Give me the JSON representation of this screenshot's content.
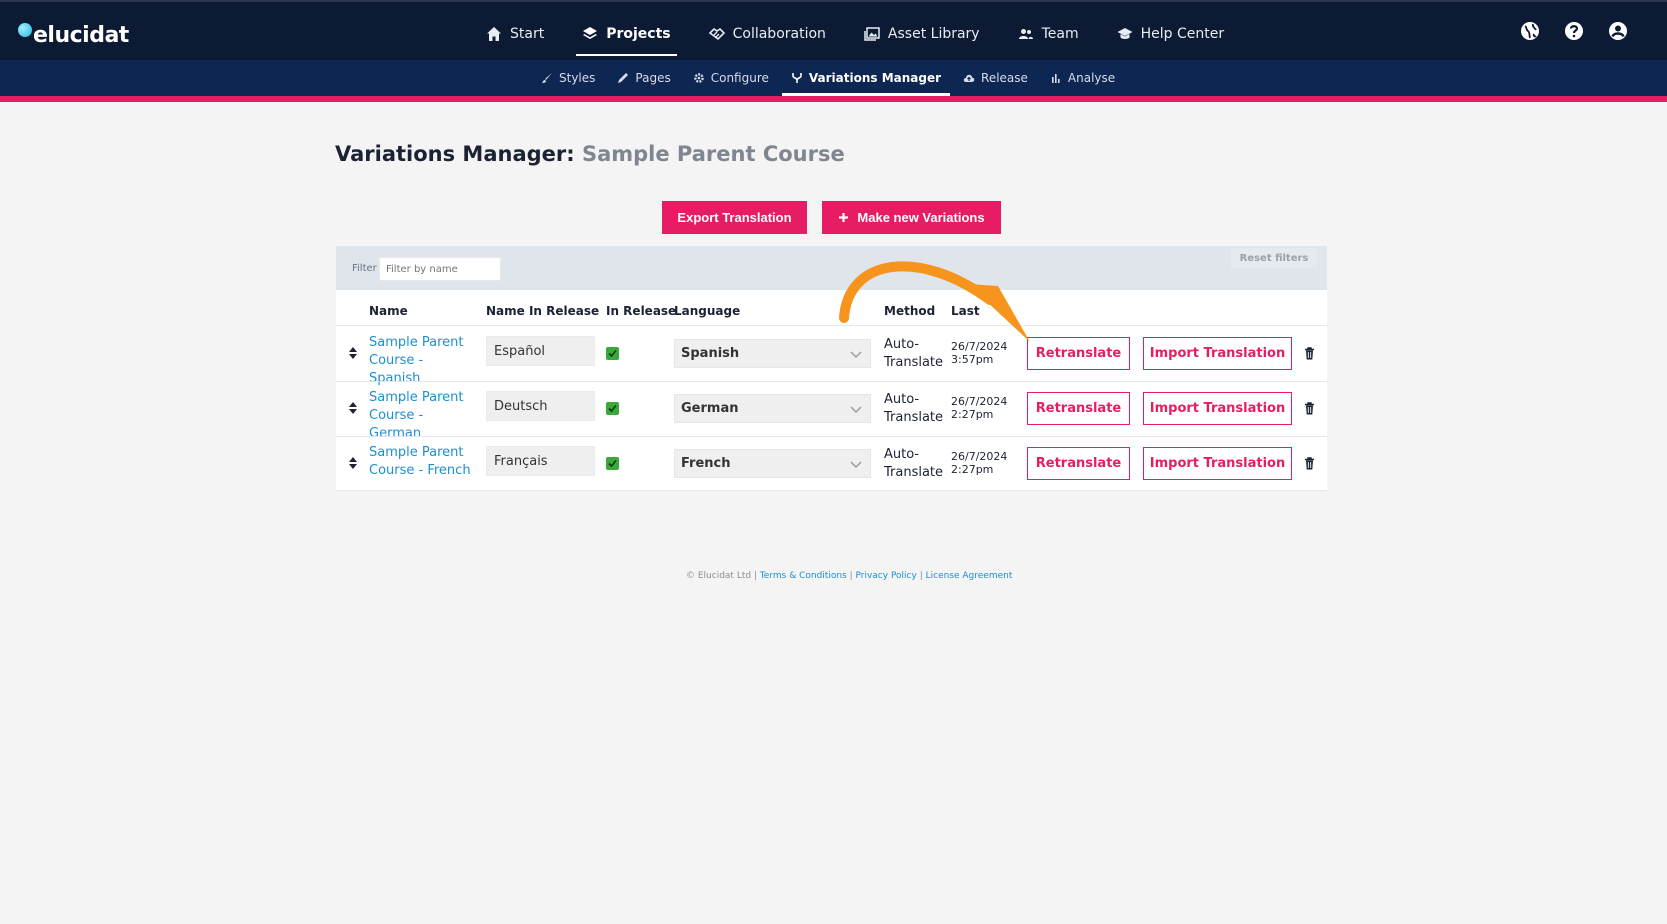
{
  "brand": {
    "name": "elucidat"
  },
  "main_nav": [
    {
      "label": "Start",
      "icon": "home-icon"
    },
    {
      "label": "Projects",
      "icon": "layers-icon",
      "active": true
    },
    {
      "label": "Collaboration",
      "icon": "handshake-icon"
    },
    {
      "label": "Asset Library",
      "icon": "images-icon"
    },
    {
      "label": "Team",
      "icon": "users-icon"
    },
    {
      "label": "Help Center",
      "icon": "graduation-cap-icon"
    }
  ],
  "header_icons": [
    "globe-icon",
    "help-icon",
    "user-icon"
  ],
  "sub_nav": [
    {
      "label": "Styles",
      "icon": "brush-icon"
    },
    {
      "label": "Pages",
      "icon": "pencil-icon"
    },
    {
      "label": "Configure",
      "icon": "gear-icon"
    },
    {
      "label": "Variations Manager",
      "icon": "fork-icon",
      "active": true
    },
    {
      "label": "Release",
      "icon": "cloud-upload-icon"
    },
    {
      "label": "Analyse",
      "icon": "bar-chart-icon"
    }
  ],
  "page": {
    "title_prefix": "Variations Manager:",
    "title_course": "Sample Parent Course",
    "export_button": "Export Translation",
    "make_button": "Make new Variations"
  },
  "filter": {
    "label": "Filter",
    "placeholder": "Filter by name",
    "reset_label": "Reset filters"
  },
  "table": {
    "headers": {
      "name": "Name",
      "name_in_release": "Name In Release",
      "in_release": "In Release",
      "language": "Language",
      "method": "Method",
      "last": "Last"
    },
    "rows": [
      {
        "name_line1": "Sample Parent",
        "name_line2": "Course - Spanish",
        "name_in_release": "Español",
        "in_release": true,
        "language": "Spanish",
        "method_line1": "Auto-",
        "method_line2": "Translate",
        "date": "26/7/2024",
        "time": "3:57pm",
        "retranslate": "Retranslate",
        "import": "Import Translation"
      },
      {
        "name_line1": "Sample Parent",
        "name_line2": "Course - German",
        "name_in_release": "Deutsch",
        "in_release": true,
        "language": "German",
        "method_line1": "Auto-",
        "method_line2": "Translate",
        "date": "26/7/2024",
        "time": "2:27pm",
        "retranslate": "Retranslate",
        "import": "Import Translation"
      },
      {
        "name_line1": "Sample Parent",
        "name_line2": "Course - French",
        "name_in_release": "Français",
        "in_release": true,
        "language": "French",
        "method_line1": "Auto-",
        "method_line2": "Translate",
        "date": "26/7/2024",
        "time": "2:27pm",
        "retranslate": "Retranslate",
        "import": "Import Translation"
      }
    ]
  },
  "footer": {
    "copyright": "© Elucidat Ltd",
    "terms": "Terms & Conditions",
    "privacy": "Privacy Policy",
    "license": "License Agreement"
  },
  "colors": {
    "accent": "#e61d65",
    "header_bg": "#0c1a33",
    "subnav_bg": "#0e2652",
    "link": "#1d8fcf",
    "annotation_arrow": "#f7941d"
  }
}
